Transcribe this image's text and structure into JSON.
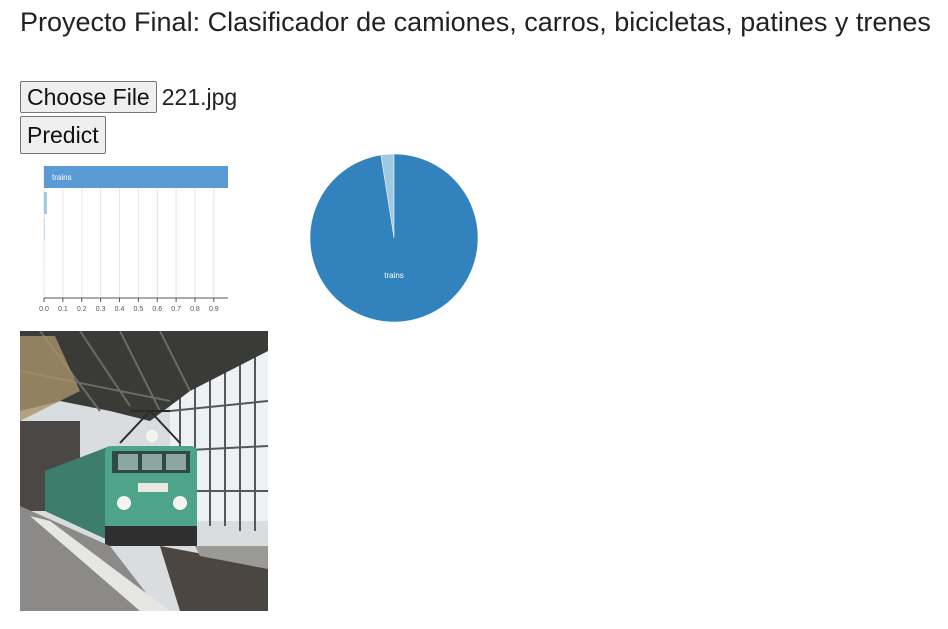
{
  "page": {
    "title": "Proyecto Final: Clasificador de camiones, carros, bicicletas, patines y trenes"
  },
  "file_input": {
    "button_label": "Choose File",
    "file_name": "221.jpg"
  },
  "predict_button": {
    "label": "Predict"
  },
  "chart_data": [
    {
      "type": "bar",
      "orientation": "horizontal",
      "categories": [
        "trains",
        "",
        "",
        "",
        ""
      ],
      "values": [
        0.975,
        0.015,
        0.005,
        0.003,
        0.002
      ],
      "xlim": [
        0,
        0.975
      ],
      "xticks": [
        "0.0",
        "0.1",
        "0.2",
        "0.3",
        "0.4",
        "0.5",
        "0.6",
        "0.7",
        "0.8",
        "0.9"
      ],
      "grid": true,
      "colors": [
        "#5b9bd5",
        "#9ecae1",
        "#c6dbef",
        "#deebf7",
        "#eff3ff"
      ]
    },
    {
      "type": "pie",
      "labels": [
        "trains",
        ""
      ],
      "values": [
        0.975,
        0.025
      ],
      "colors": [
        "#3182bd",
        "#9ecae1"
      ],
      "label_color": "#ffffff"
    }
  ],
  "photo": {
    "icon": "train-photo",
    "colors": {
      "sky": "#e8ecef",
      "roof": "#3b3b38",
      "train_body": "#4a9c86",
      "platform": "#8a8886"
    }
  }
}
